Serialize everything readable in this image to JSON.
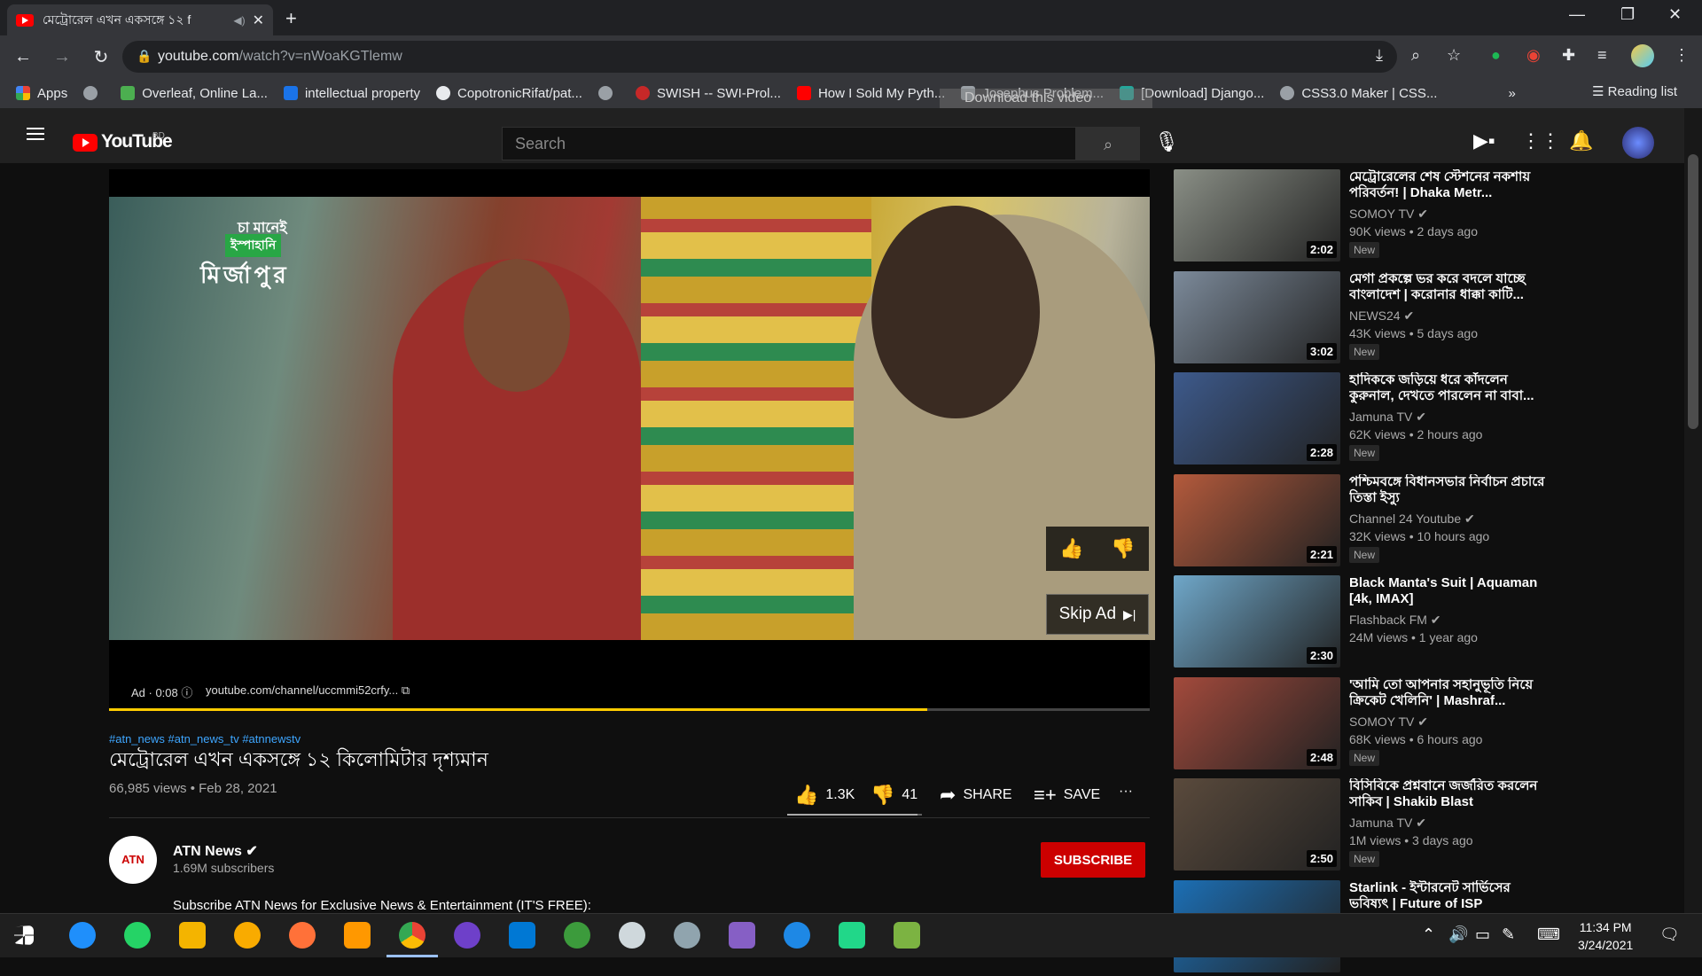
{
  "browser": {
    "tab_title": "মেট্রোরেল এখন একসঙ্গে ১২ f",
    "url_host": "youtube.com",
    "url_path": "/watch?v=nWoaKGTlemw",
    "download_hint": "Download this video"
  },
  "bookmarks": [
    {
      "label": "Apps",
      "color": "#ea4335"
    },
    {
      "label": "",
      "color": "#9aa0a6"
    },
    {
      "label": "Overleaf, Online La...",
      "color": "#4caf50"
    },
    {
      "label": "intellectual property",
      "color": "#1a73e8"
    },
    {
      "label": "CopotronicRifat/pat...",
      "color": "#e8eaed"
    },
    {
      "label": "",
      "color": "#9aa0a6"
    },
    {
      "label": "SWISH -- SWI-Prol...",
      "color": "#c62828"
    },
    {
      "label": "How I Sold My Pyth...",
      "color": "#ff0000"
    },
    {
      "label": "Josephus Problem...",
      "color": "#9aa0a6"
    },
    {
      "label": "[Download] Django...",
      "color": "#26a69a"
    },
    {
      "label": "CSS3.0 Maker | CSS...",
      "color": "#9aa0a6"
    }
  ],
  "reading_list": "Reading list",
  "youtube": {
    "logo": "YouTube",
    "country": "BD",
    "search_placeholder": "Search"
  },
  "ad": {
    "brand_line1": "চা মানেই",
    "brand_line2": "ইস্পাহানি",
    "brand_line3": "মির্জাপুর",
    "info": "Ad · 0:08 ⓘ",
    "url": "youtube.com/channel/uccmmi52crfy... ⧉",
    "skip": "Skip Ad",
    "progress": 0.786
  },
  "video": {
    "hashtags": "#atn_news #atn_news_tv #atnnewstv",
    "title": "মেট্রোরেল এখন একসঙ্গে ১২ কিলোমিটার দৃশ্যমান",
    "views": "66,985 views • Feb 28, 2021",
    "likes": "1.3K",
    "dislikes": "41",
    "like_ratio": 0.97,
    "share": "SHARE",
    "save": "SAVE"
  },
  "channel": {
    "name": "ATN News ✔",
    "subs": "1.69M subscribers",
    "avatar_text": "ATN",
    "subscribe": "SUBSCRIBE",
    "description": "Subscribe ATN News for Exclusive News & Entertainment (IT'S FREE):"
  },
  "recommendations": [
    {
      "title": "মেট্রোরেলের শেষ স্টেশনের নকশায় পরিবর্তন! | Dhaka Metr...",
      "channel": "SOMOY TV ✔",
      "views": "90K views • 2 days ago",
      "badge": "New",
      "duration": "2:02",
      "color": "#8a8f86"
    },
    {
      "title": "মেগা প্রকল্পে ভর করে বদলে যাচ্ছে বাংলাদেশ | করোনার ধাক্কা কাটি...",
      "channel": "NEWS24 ✔",
      "views": "43K views • 5 days ago",
      "badge": "New",
      "duration": "3:02",
      "color": "#7c8a9a"
    },
    {
      "title": "হাদিককে জড়িয়ে ধরে কাঁদলেন কুরুনাল, দেখতে পারলেন না বাবা...",
      "channel": "Jamuna TV ✔",
      "views": "62K views • 2 hours ago",
      "badge": "New",
      "duration": "2:28",
      "color": "#3d5a8c"
    },
    {
      "title": "পশ্চিমবঙ্গে বিধানসভার নির্বাচন প্রচারে তিস্তা ইস্যু",
      "channel": "Channel 24 Youtube ✔",
      "views": "32K views • 10 hours ago",
      "badge": "New",
      "duration": "2:21",
      "color": "#b45a3c"
    },
    {
      "title": "Black Manta's Suit | Aquaman [4k, IMAX]",
      "channel": "Flashback FM ✔",
      "views": "24M views • 1 year ago",
      "badge": "",
      "duration": "2:30",
      "color": "#6fa7c9"
    },
    {
      "title": "'আমি তো আপনার সহানুভূতি নিয়ে ক্রিকেট খেলিনি' | Mashraf...",
      "channel": "SOMOY TV ✔",
      "views": "68K views • 6 hours ago",
      "badge": "New",
      "duration": "2:48",
      "color": "#a34a3c"
    },
    {
      "title": "বিসিবিকে প্রশ্নবানে জর্জরিত করলেন সাকিব | Shakib Blast",
      "channel": "Jamuna TV ✔",
      "views": "1M views • 3 days ago",
      "badge": "New",
      "duration": "2:50",
      "color": "#5a4a3c"
    },
    {
      "title": "Starlink - ইন্টারনেট সার্ভিসের ভবিষ্যৎ | Future of ISP",
      "channel": "",
      "views": "",
      "badge": "",
      "duration": "",
      "color": "#1c6fb5"
    }
  ],
  "taskbar": {
    "time": "11:34 PM",
    "date": "3/24/2021"
  }
}
